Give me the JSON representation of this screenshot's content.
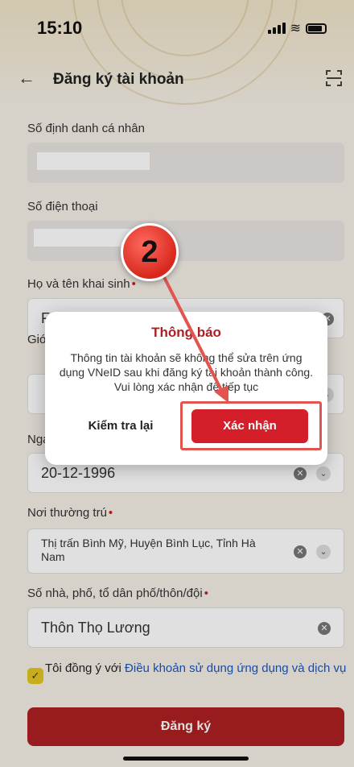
{
  "status_bar": {
    "time": "15:10"
  },
  "nav": {
    "title": "Đăng ký tài khoản"
  },
  "form": {
    "id_number": {
      "label": "Số định danh cá nhân"
    },
    "phone": {
      "label": "Số điện thoại"
    },
    "full_name": {
      "label": "Họ và tên khai sinh",
      "required": "•",
      "value": "F"
    },
    "gender": {
      "label": "Giớ"
    },
    "birth_date": {
      "label": "Nga",
      "value": "20-12-1996"
    },
    "residence": {
      "label": "Nơi thường trú",
      "required": "•",
      "value": "Thị trấn Bình Mỹ, Huyện Bình Lục, Tỉnh Hà Nam"
    },
    "address": {
      "label": "Số nhà, phố, tổ dân phố/thôn/đội",
      "required": "•",
      "value": "Thôn Thọ Lương"
    }
  },
  "agreement": {
    "prefix": "Tôi đồng ý với ",
    "link": "Điều khoản sử dụng ứng dụng và dịch vụ"
  },
  "register_button": "Đăng ký",
  "dialog": {
    "title": "Thông báo",
    "message": "Thông tin tài khoản sẽ không thể sửa trên ứng dụng VNeID sau khi đăng ký tài khoản thành công. Vui lòng xác nhận để tiếp tục",
    "check_again": "Kiểm tra lại",
    "confirm": "Xác nhận"
  },
  "annotation": {
    "step_number": "2",
    "color": "#e2554f"
  },
  "colors": {
    "brand_red": "#ad1f23",
    "confirm_red": "#d41f2a",
    "link_blue": "#1a56c4",
    "checkbox_yellow": "#e3c520"
  }
}
